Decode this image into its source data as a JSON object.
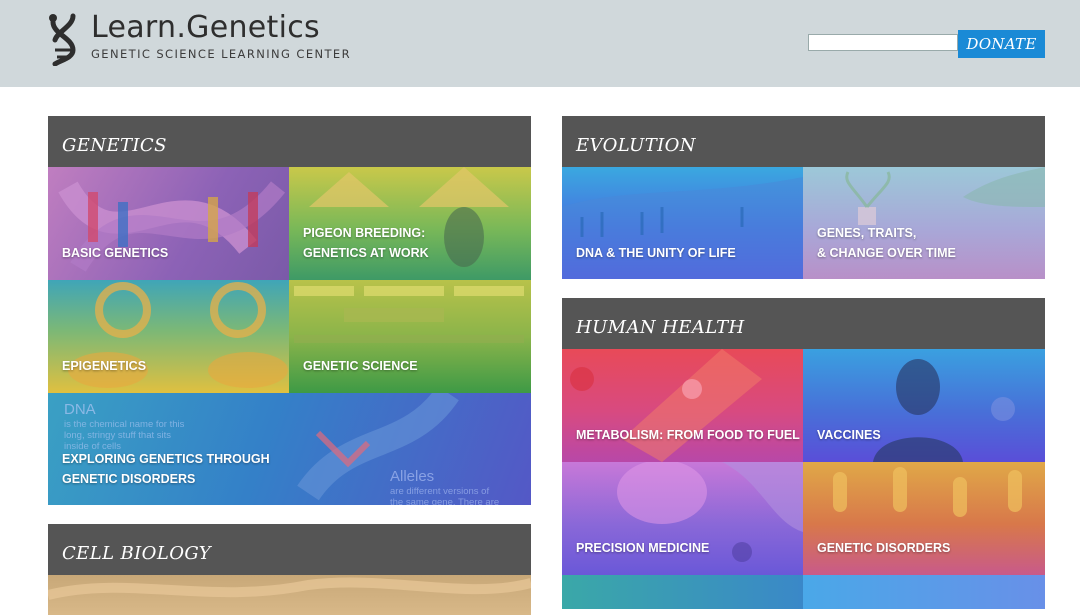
{
  "header": {
    "logo_title": "Learn.Genetics",
    "logo_subtitle": "GENETIC SCIENCE LEARNING CENTER",
    "donate_label": "DONATE",
    "search_value": ""
  },
  "sections": {
    "genetics": {
      "title": "GENETICS",
      "tiles": [
        {
          "label": "BASIC GENETICS"
        },
        {
          "label_line1": "PIGEON BREEDING:",
          "label_line2": "GENETICS AT WORK"
        },
        {
          "label": "EPIGENETICS"
        },
        {
          "label": "GENETIC SCIENCE"
        },
        {
          "label_line1": "EXPLORING GENETICS THROUGH",
          "label_line2": "GENETIC DISORDERS",
          "overlay_dna_title": "DNA",
          "overlay_dna_line1": "is the chemical name for this",
          "overlay_dna_line2": "long, stringy stuff that sits",
          "overlay_dna_line3": "inside of cells",
          "overlay_alleles_title": "Alleles",
          "overlay_alleles_line1": "are different versions of",
          "overlay_alleles_line2": "the same gene. There are"
        }
      ]
    },
    "cell_biology": {
      "title": "CELL BIOLOGY"
    },
    "evolution": {
      "title": "EVOLUTION",
      "tiles": [
        {
          "label": "DNA & THE UNITY OF LIFE"
        },
        {
          "label_line1": "GENES, TRAITS,",
          "label_line2": "& CHANGE OVER TIME"
        }
      ]
    },
    "human_health": {
      "title": "HUMAN HEALTH",
      "tiles": [
        {
          "label": "METABOLISM: FROM FOOD TO FUEL"
        },
        {
          "label": "VACCINES"
        },
        {
          "label": "PRECISION MEDICINE"
        },
        {
          "label": "GENETIC DISORDERS"
        }
      ]
    }
  },
  "colors": {
    "header_bg": "#d0d8db",
    "section_head": "#555555",
    "donate": "#1a8ad6"
  }
}
